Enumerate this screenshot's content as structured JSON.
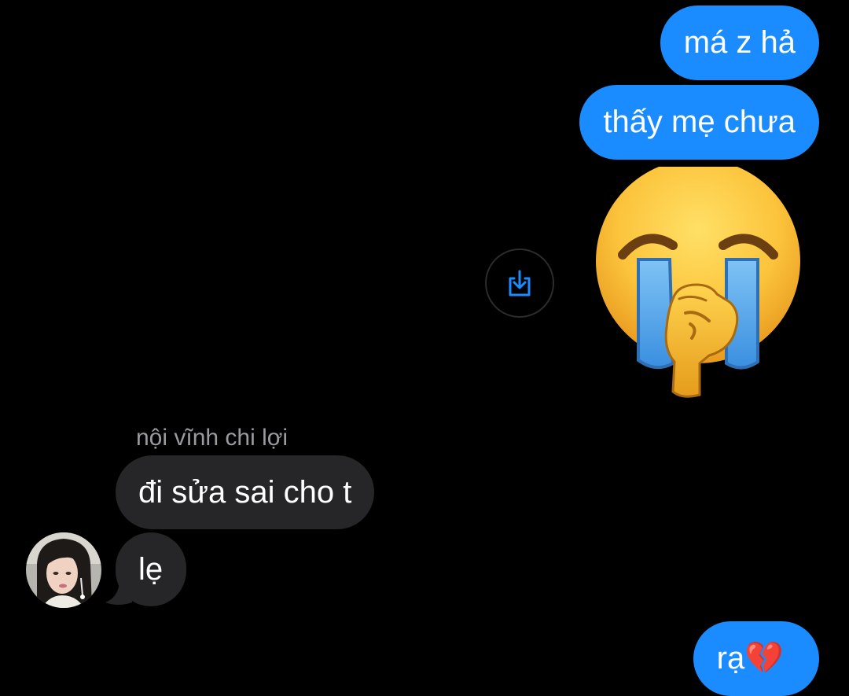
{
  "conversation": {
    "sender_name": "nội vĩnh chi lợi",
    "messages": [
      {
        "direction": "outgoing",
        "text": "má z hả"
      },
      {
        "direction": "outgoing",
        "text": "thấy mẹ chưa"
      },
      {
        "direction": "outgoing",
        "type": "sticker",
        "icon": "crying-face-with-fist-icon"
      },
      {
        "direction": "incoming",
        "text": "đi sửa sai cho t"
      },
      {
        "direction": "incoming",
        "text": "lẹ"
      },
      {
        "direction": "outgoing",
        "text": "rạ💔"
      }
    ]
  },
  "actions": {
    "save_icon": "save-to-device-icon"
  },
  "colors": {
    "background": "#000000",
    "outgoing_bubble": "#1a8cff",
    "incoming_bubble": "#262628",
    "sender_name": "#9a9a9f",
    "save_icon": "#1a8cff"
  }
}
